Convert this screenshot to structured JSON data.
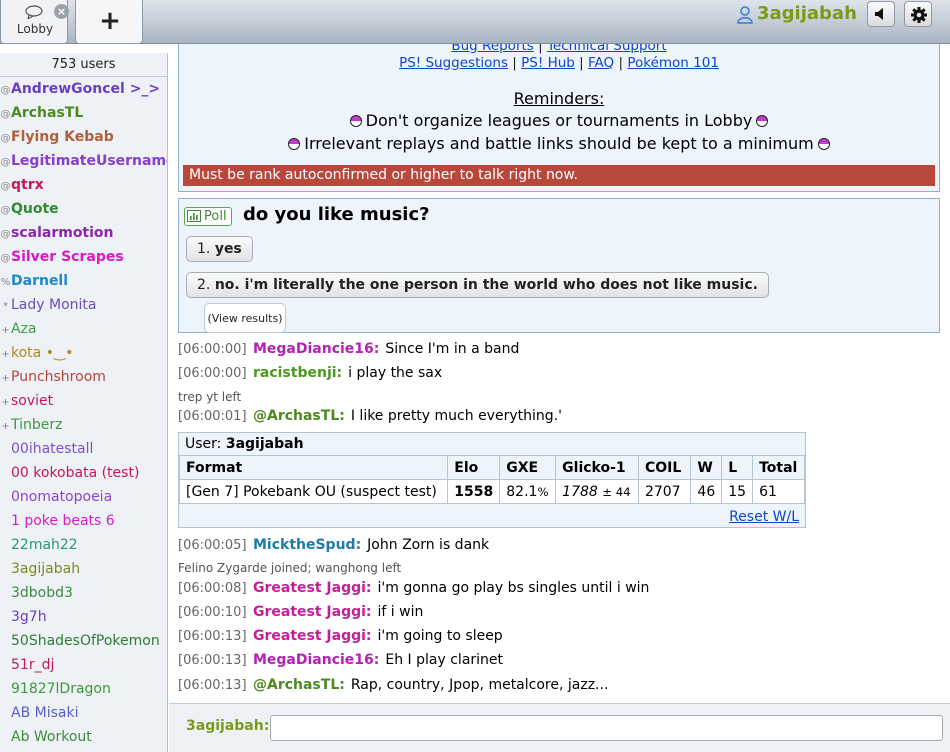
{
  "header": {
    "tabs": [
      {
        "label": "Lobby"
      }
    ],
    "close_glyph": "×",
    "add_glyph": "+",
    "username": "3agijabah",
    "icons": {
      "lobby": "chat-bubble-icon",
      "user": "user-icon",
      "volume": "volume-icon",
      "options": "gear-icon"
    }
  },
  "userlist": {
    "count": "753 users",
    "users": [
      {
        "rank": "@",
        "name": "AndrewGoncel >_>",
        "color": "#6b3ec7",
        "bold": true
      },
      {
        "rank": "@",
        "name": "ArchasTL",
        "color": "#4c8a1f",
        "bold": true
      },
      {
        "rank": "@",
        "name": "Flying Kebab",
        "color": "#b0603a",
        "bold": true
      },
      {
        "rank": "@",
        "name": "LegitimateUsername",
        "color": "#8a3dc9",
        "bold": true
      },
      {
        "rank": "@",
        "name": "qtrx",
        "color": "#c2185b",
        "bold": true
      },
      {
        "rank": "@",
        "name": "Quote",
        "color": "#2e8b2e",
        "bold": true
      },
      {
        "rank": "@",
        "name": "scalarmotion",
        "color": "#8e24aa",
        "bold": true
      },
      {
        "rank": "@",
        "name": "Silver Scrapes",
        "color": "#d81bc6",
        "bold": true
      },
      {
        "rank": "%",
        "name": "Darnell",
        "color": "#1e88c9",
        "bold": true
      },
      {
        "rank": "*",
        "name": "Lady Monita",
        "color": "#6a4fb8",
        "bold": false
      },
      {
        "rank": "+",
        "name": "Aza",
        "color": "#3f9e3f",
        "bold": false
      },
      {
        "rank": "+",
        "name": "kota •‿•",
        "color": "#b08a20",
        "bold": false
      },
      {
        "rank": "+",
        "name": "Punchshroom",
        "color": "#b8443a",
        "bold": false
      },
      {
        "rank": "+",
        "name": "soviet",
        "color": "#c2185b",
        "bold": false
      },
      {
        "rank": "+",
        "name": "Tinberz",
        "color": "#3a9a3a",
        "bold": false
      },
      {
        "rank": "",
        "name": "00ihatestall",
        "color": "#7b52c9",
        "bold": false
      },
      {
        "rank": "",
        "name": "00 kokobata (test)",
        "color": "#c2185b",
        "bold": false
      },
      {
        "rank": "",
        "name": "0nomatopoeia",
        "color": "#8e44c9",
        "bold": false
      },
      {
        "rank": "",
        "name": "1 poke beats 6",
        "color": "#d81bc6",
        "bold": false
      },
      {
        "rank": "",
        "name": "22mah22",
        "color": "#2a9a6a",
        "bold": false
      },
      {
        "rank": "",
        "name": "3agijabah",
        "color": "#7a8a1c",
        "bold": false
      },
      {
        "rank": "",
        "name": "3dbobd3",
        "color": "#3f8a3f",
        "bold": false
      },
      {
        "rank": "",
        "name": "3g7h",
        "color": "#6a3ec7",
        "bold": false
      },
      {
        "rank": "",
        "name": "50ShadesOfPokemon",
        "color": "#2e7d32",
        "bold": false
      },
      {
        "rank": "",
        "name": "51r_dj",
        "color": "#c2185b",
        "bold": false
      },
      {
        "rank": "",
        "name": "91827lDragon",
        "color": "#3a9a3a",
        "bold": false
      },
      {
        "rank": "",
        "name": "AB Misaki",
        "color": "#5b5fc7",
        "bold": false
      },
      {
        "rank": "",
        "name": "Ab Workout",
        "color": "#3f8a3f",
        "bold": false
      }
    ]
  },
  "infobox": {
    "links_top": [
      "Bug Reports",
      "Technical Support"
    ],
    "links": [
      "PS! Suggestions",
      "PS! Hub",
      "FAQ",
      "Pokémon 101"
    ],
    "separator": "|",
    "reminders_title": "Reminders:",
    "reminders": [
      "Don't organize leagues or tournaments in Lobby",
      "Irrelevant replays and battle links should be kept to a minimum"
    ],
    "warning": "Must be rank autoconfirmed or higher to talk right now."
  },
  "poll": {
    "badge": "Poll",
    "question": "do you like music?",
    "options": [
      {
        "num": "1.",
        "text": "yes"
      },
      {
        "num": "2.",
        "text": "no. i'm literally the one person in the world who does not like music."
      }
    ],
    "view_results": "(View results)"
  },
  "messages": [
    {
      "ts": "[06:00:00]",
      "author": "MegaDiancie16:",
      "color": "#b520b5",
      "text": "Since I'm in a band"
    },
    {
      "ts": "[06:00:00]",
      "author": "racistbenji:",
      "color": "#4a9a1c",
      "text": "i play the sax"
    },
    {
      "ts": "[06:00:01]",
      "author": "@ArchasTL:",
      "color": "#4c8a1f",
      "text": "I like pretty much everything.'"
    },
    {
      "ts": "[06:00:05]",
      "author": "MicktheSpud:",
      "color": "#1e7aa8",
      "text": "John Zorn is dank"
    },
    {
      "ts": "[06:00:08]",
      "author": "Greatest Jaggi:",
      "color": "#c2209a",
      "text": "i'm gonna go play bs singles until i win"
    },
    {
      "ts": "[06:00:10]",
      "author": "Greatest Jaggi:",
      "color": "#c2209a",
      "text": "if i win"
    },
    {
      "ts": "[06:00:13]",
      "author": "Greatest Jaggi:",
      "color": "#c2209a",
      "text": "i'm going to sleep"
    },
    {
      "ts": "[06:00:13]",
      "author": "MegaDiancie16:",
      "color": "#b520b5",
      "text": "Eh I play clarinet"
    },
    {
      "ts": "[06:00:13]",
      "author": "@ArchasTL:",
      "color": "#4c8a1f",
      "text": "Rap, country, Jpop, metalcore, jazz..."
    }
  ],
  "notices": [
    "trep yt left",
    "Felino Zygarde joined; wanghong left"
  ],
  "ladder": {
    "user_label": "User:",
    "user": "3agijabah",
    "headers": [
      "Format",
      "Elo",
      "GXE",
      "Glicko-1",
      "COIL",
      "W",
      "L",
      "Total"
    ],
    "row": {
      "format": "[Gen 7] Pokebank OU (suspect test)",
      "elo": "1558",
      "gxe": "82.1",
      "gxe_pct": "%",
      "glicko": "1788",
      "glicko_dev": "± 44",
      "coil": "2707",
      "w": "46",
      "l": "15",
      "total": "61"
    },
    "reset": "Reset W/L"
  },
  "input": {
    "name": "3agijabah:",
    "value": ""
  }
}
